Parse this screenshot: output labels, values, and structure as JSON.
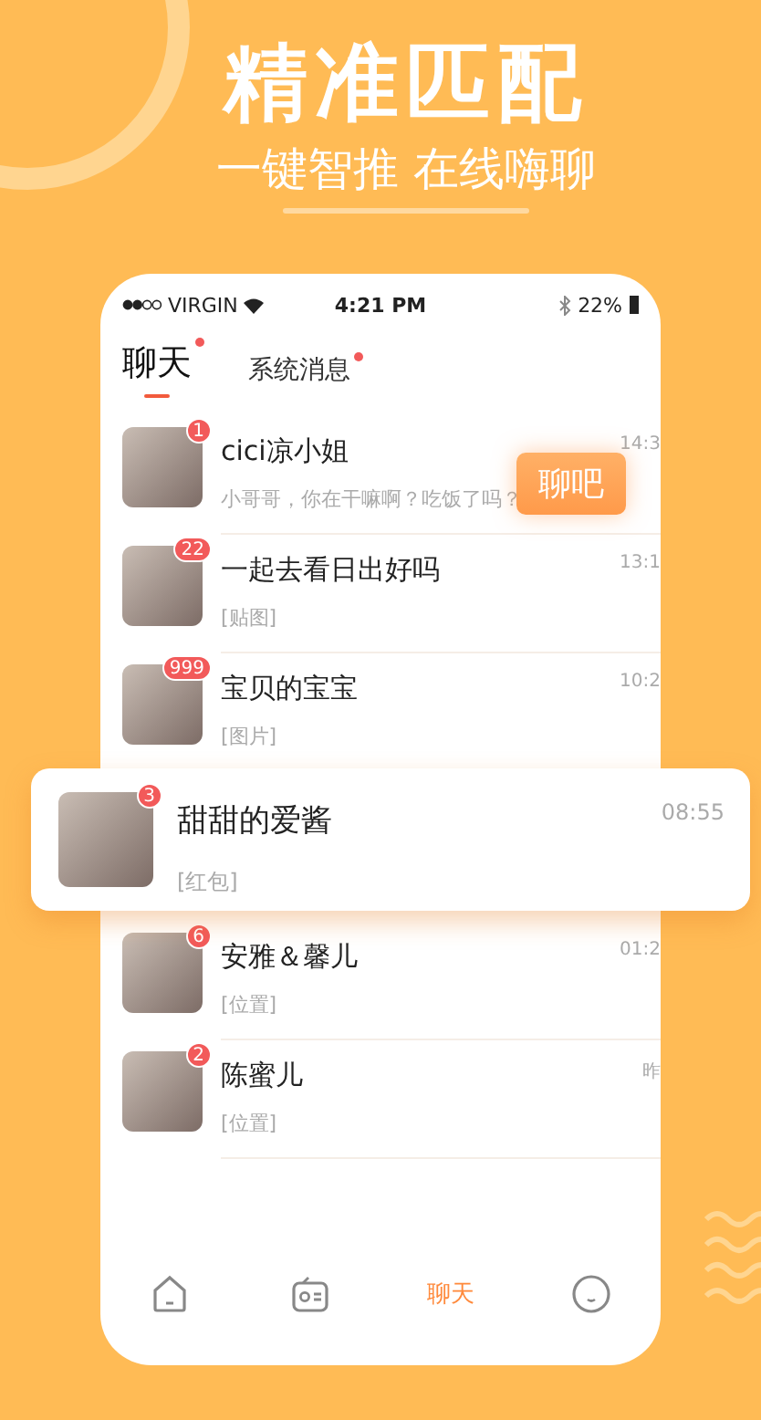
{
  "headline": "精准匹配",
  "subheadline": "一键智推 在线嗨聊",
  "status_bar": {
    "carrier": "VIRGIN",
    "time": "4:21 PM",
    "battery": "22%"
  },
  "tabs": [
    {
      "label": "聊天",
      "selected": true,
      "dot": true
    },
    {
      "label": "系统消息",
      "selected": false,
      "dot": true
    }
  ],
  "chats": [
    {
      "kind": "normal",
      "name": "cici凉小姐",
      "preview": "小哥哥，你在干嘛啊？吃饭了吗？",
      "time": "14:3",
      "badge": "1"
    },
    {
      "kind": "normal",
      "name": "一起去看日出好吗",
      "preview": "[贴图]",
      "time": "13:1",
      "badge": "22"
    },
    {
      "kind": "normal",
      "name": "宝贝的宝宝",
      "preview": "[图片]",
      "time": "10:2",
      "badge": "999"
    },
    {
      "kind": "popped",
      "name": "甜甜的爱酱",
      "preview": "[红包]",
      "time": "08:55",
      "badge": "3"
    },
    {
      "kind": "normal",
      "name": "安雅＆馨儿",
      "preview": "[位置]",
      "time": "01:2",
      "badge": "6"
    },
    {
      "kind": "normal",
      "name": "陈蜜儿",
      "preview": "[位置]",
      "time": "昨",
      "badge": "2"
    }
  ],
  "chat_bubble": "聊吧",
  "bottom_nav": [
    {
      "kind": "home",
      "selected": false
    },
    {
      "kind": "radio",
      "selected": false
    },
    {
      "kind": "text",
      "label": "聊天",
      "selected": true
    },
    {
      "kind": "face",
      "selected": false
    }
  ]
}
